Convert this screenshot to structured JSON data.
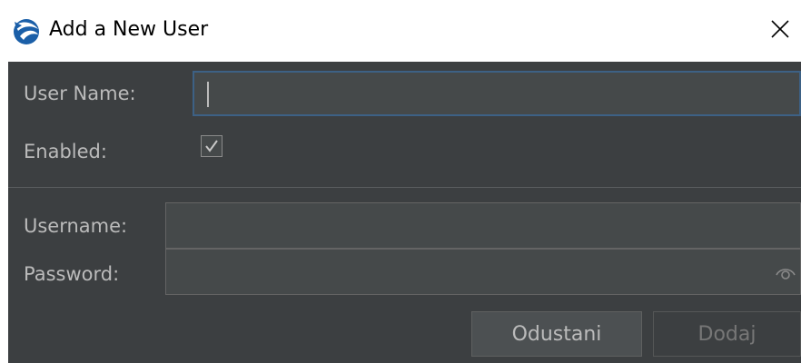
{
  "window": {
    "title": "Add a New User",
    "icon": "app-logo-icon",
    "close_icon": "close-icon"
  },
  "form": {
    "user_name_label": "User Name:",
    "user_name_value": "",
    "enabled_label": "Enabled:",
    "enabled_checked": true,
    "username_label": "Username:",
    "username_value": "",
    "password_label": "Password:",
    "password_value": "",
    "password_reveal_icon": "eye-icon"
  },
  "buttons": {
    "cancel_label": "Odustani",
    "add_label": "Dodaj"
  },
  "colors": {
    "dialog_bg": "#3c3f41",
    "field_bg": "#45494a",
    "focus_border": "#3d6185",
    "label_text": "#bbbbbb"
  }
}
